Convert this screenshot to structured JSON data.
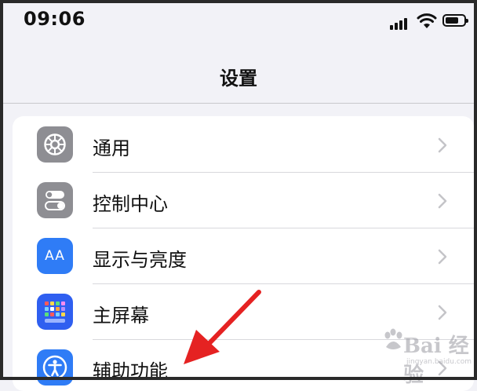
{
  "status_bar": {
    "time": "09:06"
  },
  "nav": {
    "title": "设置"
  },
  "settings": {
    "items": [
      {
        "label": "通用",
        "icon": "gear-icon",
        "icon_color": "#8e8e93"
      },
      {
        "label": "控制中心",
        "icon": "toggles-icon",
        "icon_color": "#8e8e93"
      },
      {
        "label": "显示与亮度",
        "icon": "text-size-icon",
        "icon_text": "AA",
        "icon_color": "#2f7cf6"
      },
      {
        "label": "主屏幕",
        "icon": "home-screen-grid-icon",
        "icon_color": "#2f5ff0"
      },
      {
        "label": "辅助功能",
        "icon": "accessibility-icon",
        "icon_color": "#2f7cf6"
      }
    ]
  },
  "annotation": {
    "arrow_color": "#e52222"
  },
  "watermark": {
    "brand": "Bai 经验",
    "url": "jingyan.baidu.com"
  }
}
